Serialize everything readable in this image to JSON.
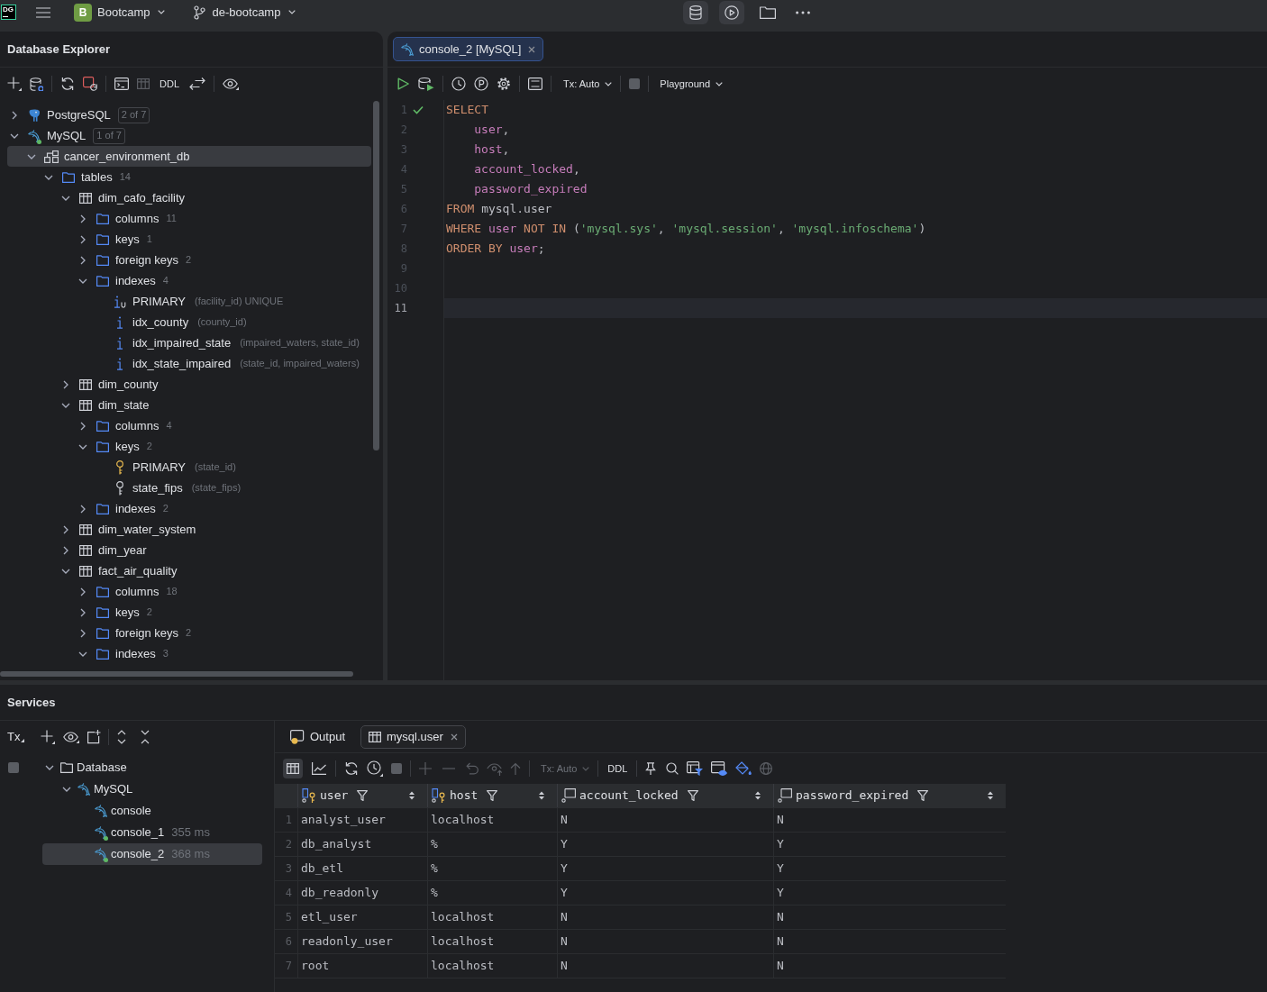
{
  "top_bar": {
    "logo": "DG",
    "project": {
      "initial": "B",
      "name": "Bootcamp"
    },
    "branch": "de-bootcamp"
  },
  "explorer": {
    "title": "Database Explorer",
    "toolbar": {
      "ddl": "DDL",
      "table_view_disabled": true
    },
    "tree": [
      {
        "label": "PostgreSQL",
        "kind": "postgres",
        "badge": "2 of 7",
        "connected": false,
        "expanded": false,
        "selected": false
      },
      {
        "label": "MySQL",
        "kind": "mysql",
        "badge": "1 of 7",
        "connected": true,
        "expanded": true,
        "selected": false,
        "children": [
          {
            "label": "cancer_environment_db",
            "kind": "schema",
            "expanded": true,
            "selected": true,
            "children": [
              {
                "label": "tables",
                "kind": "folder",
                "count": "14",
                "expanded": true,
                "selected": false,
                "children": [
                  {
                    "label": "dim_cafo_facility",
                    "kind": "table",
                    "expanded": true,
                    "selected": false,
                    "children": [
                      {
                        "label": "columns",
                        "kind": "folder",
                        "count": "11",
                        "expanded": false,
                        "selected": false
                      },
                      {
                        "label": "keys",
                        "kind": "folder",
                        "count": "1",
                        "expanded": false,
                        "selected": false
                      },
                      {
                        "label": "foreign keys",
                        "kind": "folder",
                        "count": "2",
                        "expanded": false,
                        "selected": false
                      },
                      {
                        "label": "indexes",
                        "kind": "folder",
                        "count": "4",
                        "expanded": true,
                        "selected": false,
                        "children": [
                          {
                            "label": "PRIMARY",
                            "kind": "unique_index",
                            "detail": "(facility_id) UNIQUE",
                            "selected": false
                          },
                          {
                            "label": "idx_county",
                            "kind": "index",
                            "detail": "(county_id)",
                            "selected": false
                          },
                          {
                            "label": "idx_impaired_state",
                            "kind": "index",
                            "detail": "(impaired_waters, state_id)",
                            "selected": false
                          },
                          {
                            "label": "idx_state_impaired",
                            "kind": "index",
                            "detail": "(state_id, impaired_waters)",
                            "selected": false
                          }
                        ]
                      }
                    ]
                  },
                  {
                    "label": "dim_county",
                    "kind": "table",
                    "expanded": false,
                    "selected": false
                  },
                  {
                    "label": "dim_state",
                    "kind": "table",
                    "expanded": true,
                    "selected": false,
                    "children": [
                      {
                        "label": "columns",
                        "kind": "folder",
                        "count": "4",
                        "expanded": false,
                        "selected": false
                      },
                      {
                        "label": "keys",
                        "kind": "folder",
                        "count": "2",
                        "expanded": true,
                        "selected": false,
                        "children": [
                          {
                            "label": "PRIMARY",
                            "kind": "primary_key",
                            "detail": "(state_id)",
                            "selected": false
                          },
                          {
                            "label": "state_fips",
                            "kind": "key",
                            "detail": "(state_fips)",
                            "selected": false
                          }
                        ]
                      },
                      {
                        "label": "indexes",
                        "kind": "folder",
                        "count": "2",
                        "expanded": false,
                        "selected": false
                      }
                    ]
                  },
                  {
                    "label": "dim_water_system",
                    "kind": "table",
                    "expanded": false,
                    "selected": false
                  },
                  {
                    "label": "dim_year",
                    "kind": "table",
                    "expanded": false,
                    "selected": false
                  },
                  {
                    "label": "fact_air_quality",
                    "kind": "table",
                    "expanded": true,
                    "selected": false,
                    "children": [
                      {
                        "label": "columns",
                        "kind": "folder",
                        "count": "18",
                        "expanded": false,
                        "selected": false
                      },
                      {
                        "label": "keys",
                        "kind": "folder",
                        "count": "2",
                        "expanded": false,
                        "selected": false
                      },
                      {
                        "label": "foreign keys",
                        "kind": "folder",
                        "count": "2",
                        "expanded": false,
                        "selected": false
                      },
                      {
                        "label": "indexes",
                        "kind": "folder",
                        "count": "3",
                        "expanded": true,
                        "selected": false
                      }
                    ]
                  }
                ]
              }
            ]
          }
        ]
      }
    ]
  },
  "editor": {
    "tabs": [
      {
        "label": "console_2 [MySQL]",
        "selected": true
      }
    ],
    "toolbar": {
      "tx_mode": {
        "label": "Tx: Auto",
        "disabled": false
      },
      "stop_disabled": true,
      "session": "Playground"
    },
    "lines": [
      {
        "number": "1",
        "executed": true,
        "current": false,
        "indent": false,
        "tokens": [
          {
            "text": "SELECT",
            "kind": "keyword"
          }
        ]
      },
      {
        "number": "2",
        "executed": false,
        "current": false,
        "indent": true,
        "tokens": [
          {
            "text": "user",
            "kind": "column"
          },
          {
            "text": ",",
            "kind": "plain"
          }
        ]
      },
      {
        "number": "3",
        "executed": false,
        "current": false,
        "indent": true,
        "tokens": [
          {
            "text": "host",
            "kind": "column"
          },
          {
            "text": ",",
            "kind": "plain"
          }
        ]
      },
      {
        "number": "4",
        "executed": false,
        "current": false,
        "indent": true,
        "tokens": [
          {
            "text": "account_locked",
            "kind": "column"
          },
          {
            "text": ",",
            "kind": "plain"
          }
        ]
      },
      {
        "number": "5",
        "executed": false,
        "current": false,
        "indent": true,
        "tokens": [
          {
            "text": "password_expired",
            "kind": "column"
          }
        ]
      },
      {
        "number": "6",
        "executed": false,
        "current": false,
        "indent": false,
        "tokens": [
          {
            "text": "FROM",
            "kind": "keyword"
          },
          {
            "text": " mysql.user",
            "kind": "plain"
          }
        ]
      },
      {
        "number": "7",
        "executed": false,
        "current": false,
        "indent": false,
        "tokens": [
          {
            "text": "WHERE ",
            "kind": "keyword"
          },
          {
            "text": "user",
            "kind": "column"
          },
          {
            "text": " NOT IN",
            "kind": "keyword"
          },
          {
            "text": " (",
            "kind": "plain"
          },
          {
            "text": "'mysql.sys'",
            "kind": "string"
          },
          {
            "text": ", ",
            "kind": "plain"
          },
          {
            "text": "'mysql.session'",
            "kind": "string"
          },
          {
            "text": ", ",
            "kind": "plain"
          },
          {
            "text": "'mysql.infoschema'",
            "kind": "string"
          },
          {
            "text": ")",
            "kind": "plain"
          }
        ]
      },
      {
        "number": "8",
        "executed": false,
        "current": false,
        "indent": false,
        "tokens": [
          {
            "text": "ORDER BY ",
            "kind": "keyword"
          },
          {
            "text": "user",
            "kind": "column"
          },
          {
            "text": ";",
            "kind": "plain"
          }
        ]
      },
      {
        "number": "9",
        "executed": false,
        "current": false
      },
      {
        "number": "10",
        "executed": false,
        "current": false
      },
      {
        "number": "11",
        "executed": false,
        "current": true
      }
    ]
  },
  "services": {
    "title": "Services",
    "toolbar_label": "Tx",
    "tree": [
      {
        "label": "Database",
        "kind": "group",
        "expanded": true,
        "selected": false,
        "children": [
          {
            "label": "MySQL",
            "kind": "mysql",
            "connected": false,
            "expanded": true,
            "selected": false,
            "children": [
              {
                "label": "console",
                "kind": "console",
                "connected": false,
                "selected": false
              },
              {
                "label": "console_1",
                "kind": "console",
                "connected": true,
                "time": "355 ms",
                "selected": false
              },
              {
                "label": "console_2",
                "kind": "console",
                "connected": true,
                "time": "368 ms",
                "selected": true
              }
            ]
          }
        ]
      }
    ],
    "results": {
      "tabs": [
        {
          "label": "Output",
          "kind": "output",
          "selected": false
        },
        {
          "label": "mysql.user",
          "kind": "table",
          "selected": true
        }
      ],
      "toolbar": {
        "view_modes": [
          {
            "kind": "table",
            "selected": true
          },
          {
            "kind": "chart",
            "selected": false
          }
        ],
        "stop_disabled": true,
        "edit_disabled": true,
        "tx_mode": {
          "label": "Tx: Auto",
          "disabled": true
        },
        "ddl": "DDL",
        "web_disabled": true
      },
      "table": {
        "columns": [
          {
            "label": "user",
            "key": true
          },
          {
            "label": "host",
            "key": true
          },
          {
            "label": "account_locked",
            "key": false
          },
          {
            "label": "password_expired",
            "key": false
          }
        ],
        "rows": [
          {
            "number": "1",
            "cells": [
              "analyst_user",
              "localhost",
              "N",
              "N"
            ]
          },
          {
            "number": "2",
            "cells": [
              "db_analyst",
              "%",
              "Y",
              "Y"
            ]
          },
          {
            "number": "3",
            "cells": [
              "db_etl",
              "%",
              "Y",
              "Y"
            ]
          },
          {
            "number": "4",
            "cells": [
              "db_readonly",
              "%",
              "Y",
              "Y"
            ]
          },
          {
            "number": "5",
            "cells": [
              "etl_user",
              "localhost",
              "N",
              "N"
            ]
          },
          {
            "number": "6",
            "cells": [
              "readonly_user",
              "localhost",
              "N",
              "N"
            ]
          },
          {
            "number": "7",
            "cells": [
              "root",
              "localhost",
              "N",
              "N"
            ]
          }
        ]
      }
    }
  }
}
